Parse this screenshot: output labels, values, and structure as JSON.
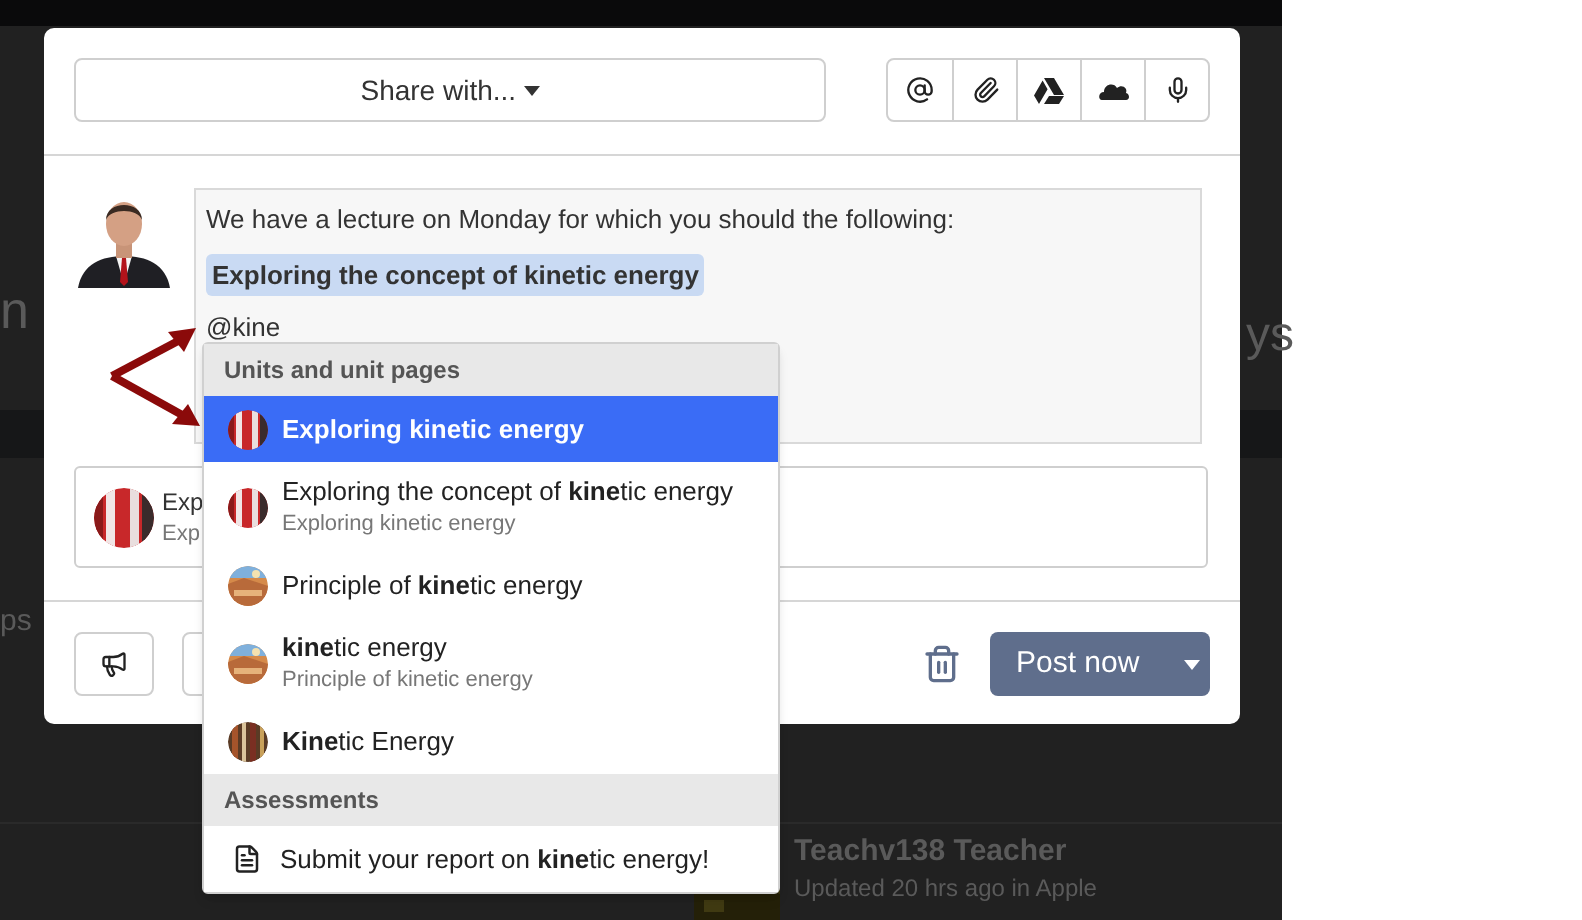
{
  "background": {
    "texts": [
      {
        "kind": "left",
        "text": "n"
      },
      {
        "kind": "right",
        "text": "ys"
      },
      {
        "kind": "menu",
        "text": "ps"
      }
    ],
    "post": {
      "author": "Teachv138 Teacher",
      "meta": "Updated 20 hrs ago",
      "place_prefix": "in",
      "place": "Apple"
    }
  },
  "modal": {
    "share_button": "Share with...",
    "message": {
      "line": "We have a lecture on Monday for which you should the following:",
      "mention": "Exploring the concept of kinetic energy",
      "typing": "@kine"
    },
    "attachment": {
      "title": "Exp",
      "subtitle": "Exp"
    },
    "post_button": "Post now"
  },
  "mention_menu": {
    "groups": [
      {
        "title": "Units and unit pages",
        "items": [
          {
            "kind": "picture",
            "title": "Exploring **kine**tic energy",
            "selected": true
          },
          {
            "kind": "picture",
            "title": "Exploring the concept of **kine**tic energy",
            "subtitle": "Exploring kinetic energy",
            "selected": false
          },
          {
            "kind": "picture",
            "title": "Principle of **kine**tic energy",
            "selected": false
          },
          {
            "kind": "picture",
            "title": "**kine**tic energy",
            "subtitle": "Principle of kinetic energy",
            "selected": false
          },
          {
            "kind": "picture",
            "title": "**Kine**tic Energy",
            "selected": false
          }
        ]
      },
      {
        "title": "Assessments",
        "items": [
          {
            "kind": "document",
            "title": "Submit your report on **kine**tic energy!",
            "selected": false
          }
        ]
      }
    ]
  }
}
